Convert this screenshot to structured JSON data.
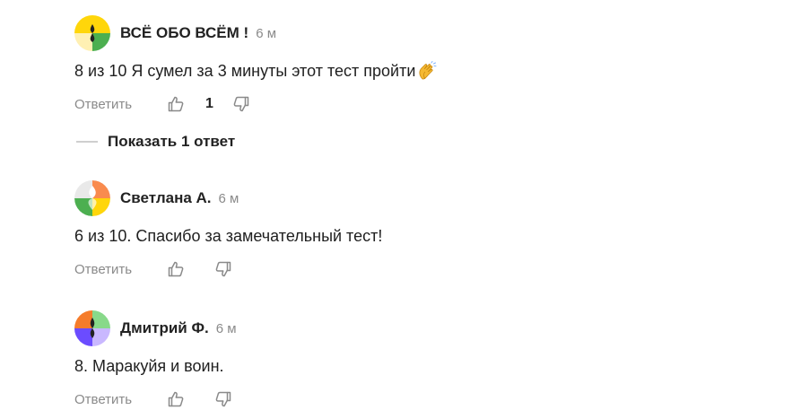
{
  "comments": [
    {
      "author": "ВСЁ ОБО ВСЁМ !",
      "time": "6 м",
      "text": "8 из 10 Я сумел за 3 минуты этот тест пройти",
      "emoji": "clapping-hands",
      "reply_label": "Ответить",
      "likes": "1",
      "avatar_colors": [
        "#ffd60a",
        "#fff0b3",
        "#4caf50"
      ]
    },
    {
      "author": "Светлана А.",
      "time": "6 м",
      "text": "6 из 10. Спасибо за замечательный тест!",
      "reply_label": "Ответить",
      "avatar_colors": [
        "#f98b4e",
        "#ffd60a",
        "#4caf50",
        "#e9e9e9"
      ]
    },
    {
      "author": "Дмитрий Ф.",
      "time": "6 м",
      "text": "8. Маракуйя и воин.",
      "reply_label": "Ответить",
      "avatar_colors": [
        "#f57c2b",
        "#88d98a",
        "#6b4cff",
        "#c9b8ff"
      ]
    }
  ],
  "show_replies_label": "Показать 1 ответ",
  "icons": {
    "like": "thumbs-up-icon",
    "dislike": "thumbs-down-icon"
  }
}
